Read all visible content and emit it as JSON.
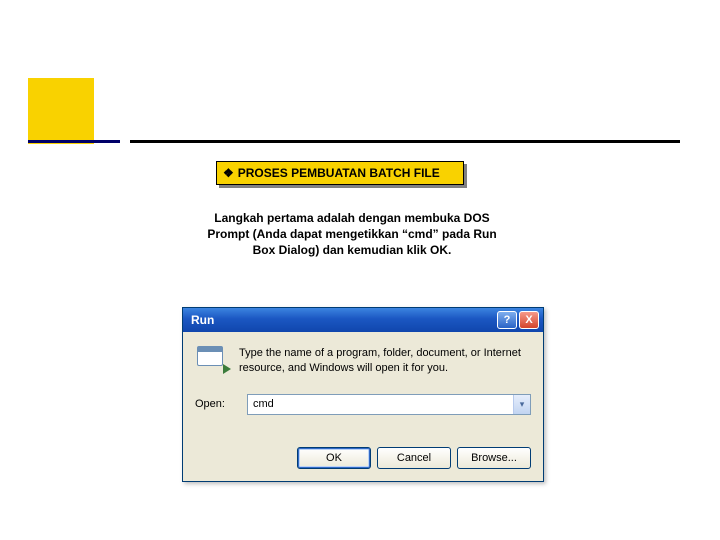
{
  "banner": {
    "bullet": "❖",
    "title": "PROSES PEMBUATAN BATCH FILE"
  },
  "description": "Langkah pertama adalah dengan membuka DOS Prompt (Anda dapat mengetikkan “cmd” pada Run Box Dialog) dan kemudian klik OK.",
  "run_dialog": {
    "title": "Run",
    "help_symbol": "?",
    "close_symbol": "X",
    "hint": "Type the name of a program, folder, document, or Internet resource, and Windows will open it for you.",
    "open_label": "Open:",
    "open_value": "cmd",
    "dropdown_glyph": "▾",
    "buttons": {
      "ok": "OK",
      "cancel": "Cancel",
      "browse": "Browse..."
    }
  }
}
